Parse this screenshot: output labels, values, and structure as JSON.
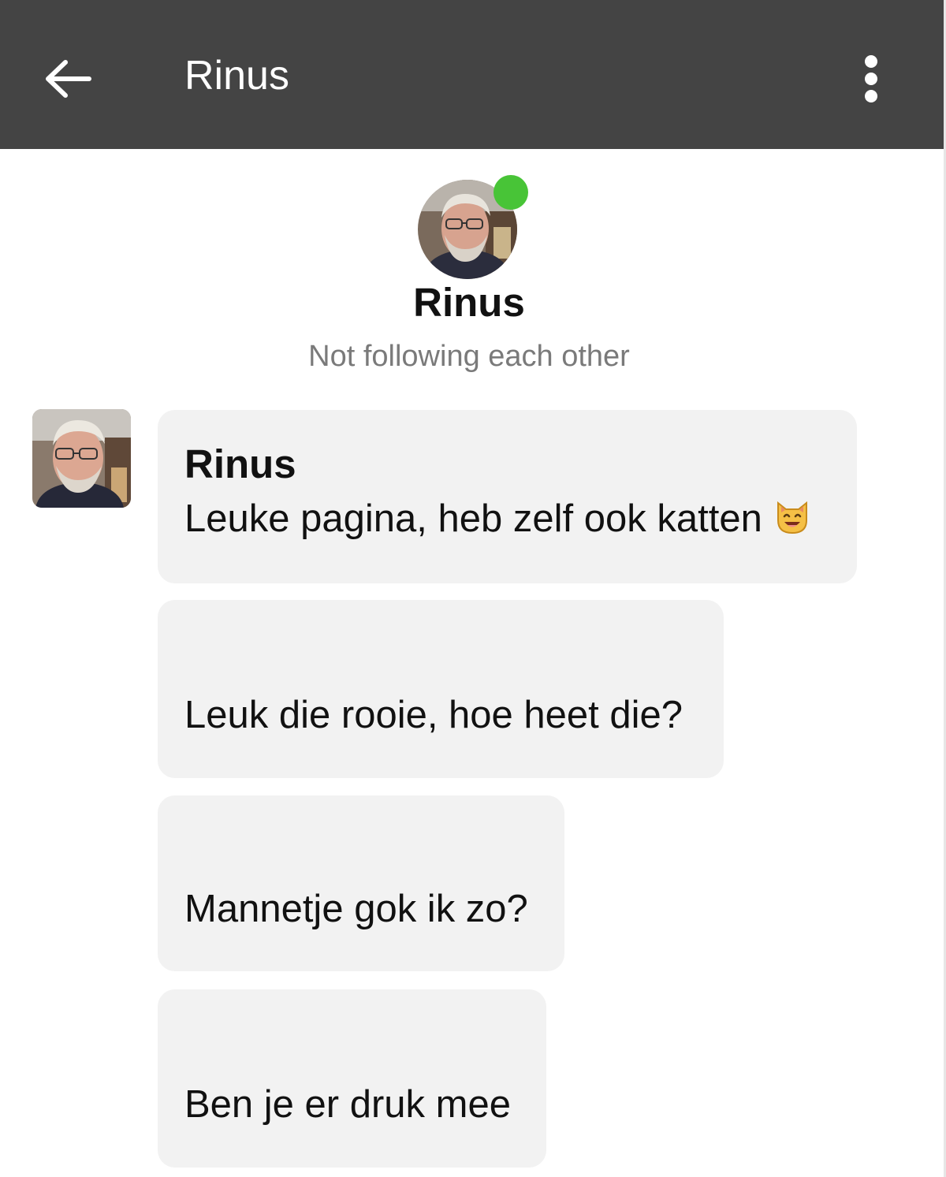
{
  "topbar": {
    "back_icon": "arrow-left-icon",
    "title": "Rinus",
    "more_icon": "more-vertical-icon"
  },
  "profile": {
    "name": "Rinus",
    "status": "Not following each other",
    "online": true,
    "online_color": "#48c437"
  },
  "messages": [
    {
      "sender": "Rinus",
      "text": "Leuke pagina, heb zelf ook katten",
      "emoji": "smiling-cat-icon"
    },
    {
      "text": "Leuk die rooie, hoe heet die?"
    },
    {
      "text": "Mannetje gok ik zo?"
    },
    {
      "text": "Ben je er druk mee"
    }
  ],
  "colors": {
    "topbar_bg": "#444444",
    "bubble_bg": "#f2f2f2",
    "status_text": "#7a7a7a"
  }
}
